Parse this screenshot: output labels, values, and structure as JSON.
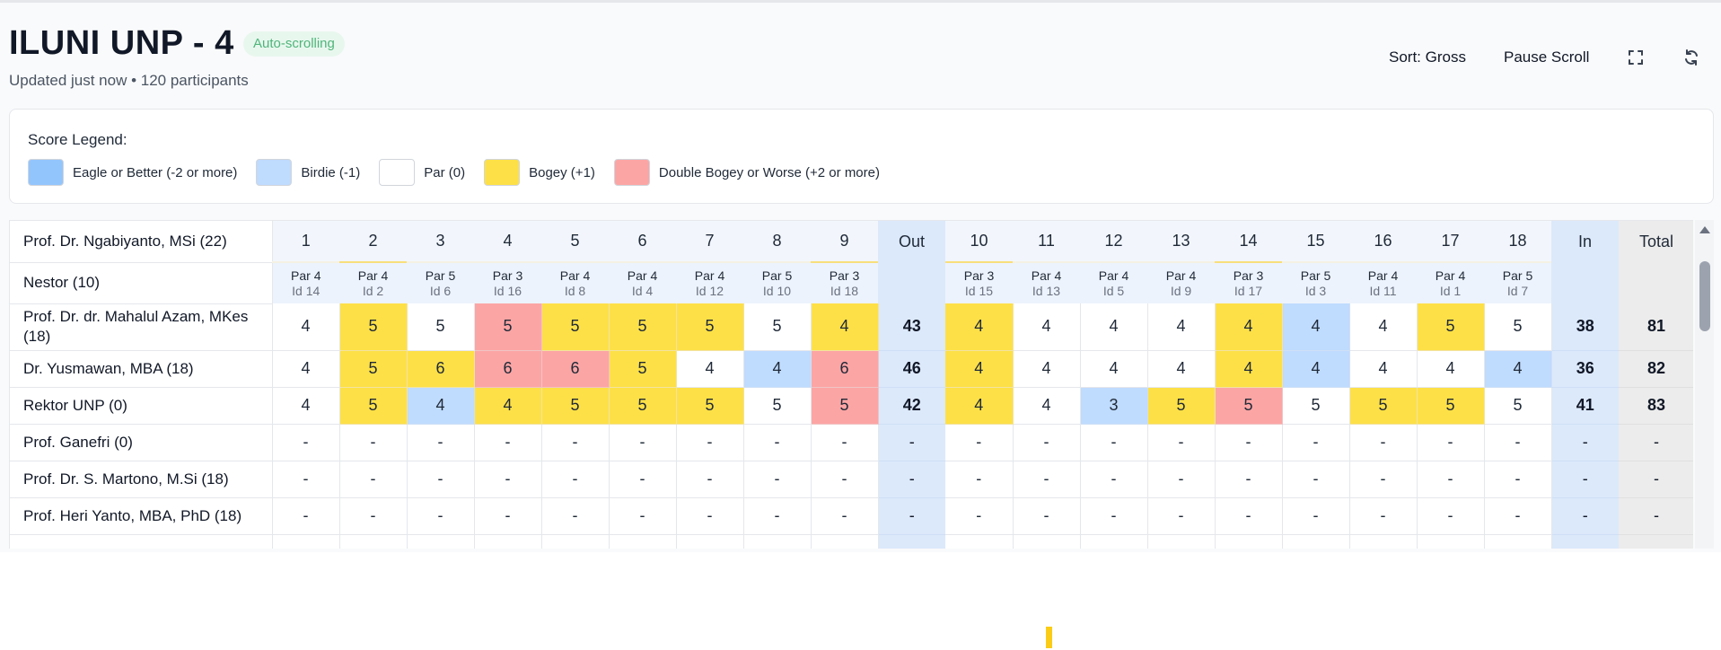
{
  "header": {
    "title": "ILUNI UNP - 4",
    "badge": "Auto-scrolling",
    "subtitle": "Updated just now • 120 participants",
    "sort_label": "Sort: Gross",
    "pause_label": "Pause Scroll",
    "icons": [
      "fullscreen-icon",
      "refresh-icon"
    ]
  },
  "legend": {
    "title": "Score Legend:",
    "items": [
      {
        "label": "Eagle or Better (-2 or more)",
        "color": "#93c5fd"
      },
      {
        "label": "Birdie (-1)",
        "color": "#bfdbfe"
      },
      {
        "label": "Par (0)",
        "color": "#ffffff"
      },
      {
        "label": "Bogey (+1)",
        "color": "#fde047"
      },
      {
        "label": "Double Bogey or Worse (+2 or more)",
        "color": "#fca5a5"
      }
    ]
  },
  "table": {
    "header_player": "Prof. Dr. Ngabiyanto, MSi (22)",
    "par_row_player": "Nestor (10)",
    "front_holes": [
      "1",
      "2",
      "3",
      "4",
      "5",
      "6",
      "7",
      "8",
      "9"
    ],
    "back_holes": [
      "10",
      "11",
      "12",
      "13",
      "14",
      "15",
      "16",
      "17",
      "18"
    ],
    "out_label": "Out",
    "in_label": "In",
    "total_label": "Total",
    "front_par": [
      {
        "par": "Par 4",
        "id": "Id 14"
      },
      {
        "par": "Par 4",
        "id": "Id 2"
      },
      {
        "par": "Par 5",
        "id": "Id 6"
      },
      {
        "par": "Par 3",
        "id": "Id 16"
      },
      {
        "par": "Par 4",
        "id": "Id 8"
      },
      {
        "par": "Par 4",
        "id": "Id 4"
      },
      {
        "par": "Par 4",
        "id": "Id 12"
      },
      {
        "par": "Par 5",
        "id": "Id 10"
      },
      {
        "par": "Par 3",
        "id": "Id 18"
      }
    ],
    "back_par": [
      {
        "par": "Par 3",
        "id": "Id 15"
      },
      {
        "par": "Par 4",
        "id": "Id 13"
      },
      {
        "par": "Par 4",
        "id": "Id 5"
      },
      {
        "par": "Par 4",
        "id": "Id 9"
      },
      {
        "par": "Par 3",
        "id": "Id 17"
      },
      {
        "par": "Par 5",
        "id": "Id 3"
      },
      {
        "par": "Par 4",
        "id": "Id 11"
      },
      {
        "par": "Par 4",
        "id": "Id 1"
      },
      {
        "par": "Par 5",
        "id": "Id 7"
      }
    ],
    "rows": [
      {
        "name": "Prof. Dr. dr. Mahalul Azam, MKes (18)",
        "front": [
          "4",
          "5",
          "5",
          "5",
          "5",
          "5",
          "5",
          "5",
          "4"
        ],
        "front_cls": [
          "",
          "bogey",
          "",
          "dbl",
          "bogey",
          "bogey",
          "bogey",
          "",
          "bogey"
        ],
        "out": "43",
        "back": [
          "4",
          "4",
          "4",
          "4",
          "4",
          "4",
          "4",
          "5",
          "5"
        ],
        "back_cls": [
          "bogey",
          "",
          "",
          "",
          "bogey",
          "birdie",
          "",
          "bogey",
          ""
        ],
        "in": "38",
        "total": "81"
      },
      {
        "name": "Dr. Yusmawan, MBA (18)",
        "front": [
          "4",
          "5",
          "6",
          "6",
          "6",
          "5",
          "4",
          "4",
          "6"
        ],
        "front_cls": [
          "",
          "bogey",
          "bogey",
          "dbl",
          "dbl",
          "bogey",
          "",
          "birdie",
          "dbl"
        ],
        "out": "46",
        "back": [
          "4",
          "4",
          "4",
          "4",
          "4",
          "4",
          "4",
          "4",
          "4"
        ],
        "back_cls": [
          "bogey",
          "",
          "",
          "",
          "bogey",
          "birdie",
          "",
          "",
          "birdie"
        ],
        "in": "36",
        "total": "82"
      },
      {
        "name": "Rektor UNP (0)",
        "front": [
          "4",
          "5",
          "4",
          "4",
          "5",
          "5",
          "5",
          "5",
          "5"
        ],
        "front_cls": [
          "",
          "bogey",
          "birdie",
          "bogey",
          "bogey",
          "bogey",
          "bogey",
          "",
          "dbl"
        ],
        "out": "42",
        "back": [
          "4",
          "4",
          "3",
          "5",
          "5",
          "5",
          "5",
          "5",
          "5"
        ],
        "back_cls": [
          "bogey",
          "",
          "birdie",
          "bogey",
          "dbl",
          "",
          "bogey",
          "bogey",
          ""
        ],
        "in": "41",
        "total": "83"
      },
      {
        "name": "Prof. Ganefri (0)",
        "front": [
          "-",
          "-",
          "-",
          "-",
          "-",
          "-",
          "-",
          "-",
          "-"
        ],
        "front_cls": [
          "",
          "",
          "",
          "",
          "",
          "",
          "",
          "",
          ""
        ],
        "out": "-",
        "back": [
          "-",
          "-",
          "-",
          "-",
          "-",
          "-",
          "-",
          "-",
          "-"
        ],
        "back_cls": [
          "",
          "",
          "",
          "",
          "",
          "",
          "",
          "",
          ""
        ],
        "in": "-",
        "total": "-"
      },
      {
        "name": "Prof. Dr. S. Martono, M.Si (18)",
        "front": [
          "-",
          "-",
          "-",
          "-",
          "-",
          "-",
          "-",
          "-",
          "-"
        ],
        "front_cls": [
          "",
          "",
          "",
          "",
          "",
          "",
          "",
          "",
          ""
        ],
        "out": "-",
        "back": [
          "-",
          "-",
          "-",
          "-",
          "-",
          "-",
          "-",
          "-",
          "-"
        ],
        "back_cls": [
          "",
          "",
          "",
          "",
          "",
          "",
          "",
          "",
          ""
        ],
        "in": "-",
        "total": "-"
      },
      {
        "name": "Prof. Heri Yanto, MBA, PhD (18)",
        "front": [
          "-",
          "-",
          "-",
          "-",
          "-",
          "-",
          "-",
          "-",
          "-"
        ],
        "front_cls": [
          "",
          "",
          "",
          "",
          "",
          "",
          "",
          "",
          ""
        ],
        "out": "-",
        "back": [
          "-",
          "-",
          "-",
          "-",
          "-",
          "-",
          "-",
          "-",
          "-"
        ],
        "back_cls": [
          "",
          "",
          "",
          "",
          "",
          "",
          "",
          "",
          ""
        ],
        "in": "-",
        "total": "-"
      }
    ]
  }
}
